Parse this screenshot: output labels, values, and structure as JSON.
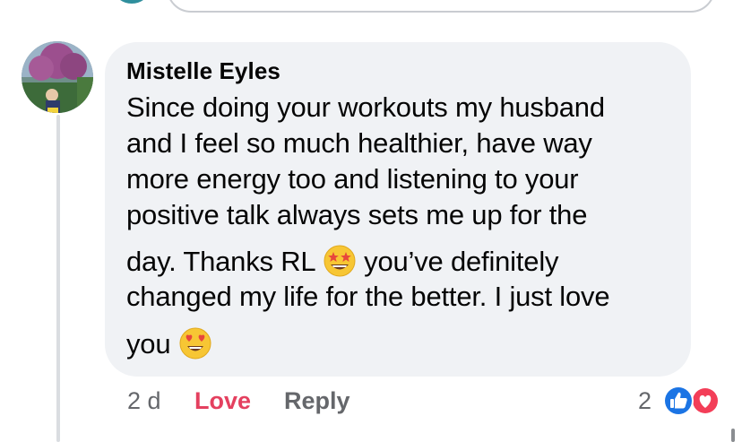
{
  "comment": {
    "author": "Mistelle Eyles",
    "lines": [
      "Since doing your workouts my husband",
      "and I feel so much healthier, have way",
      "more energy too and listening to your",
      "positive talk always sets me up for the"
    ],
    "line5_before": "day. Thanks RL",
    "line5_after": "you’ve definitely",
    "line6": "changed my life for the better. I just love",
    "line7": "you",
    "emoji_1": "star-struck-emoji",
    "emoji_2": "heart-eyes-emoji"
  },
  "meta": {
    "time": "2 d",
    "love_label": "Love",
    "reply_label": "Reply",
    "reaction_count": "2",
    "reaction_icons": [
      "like-icon",
      "love-icon"
    ]
  },
  "colors": {
    "bubble": "#f0f2f5",
    "love": "#e4405f",
    "meta_grey": "#65676b",
    "like_blue": "#1b74e4",
    "love_red": "#f33e58"
  }
}
